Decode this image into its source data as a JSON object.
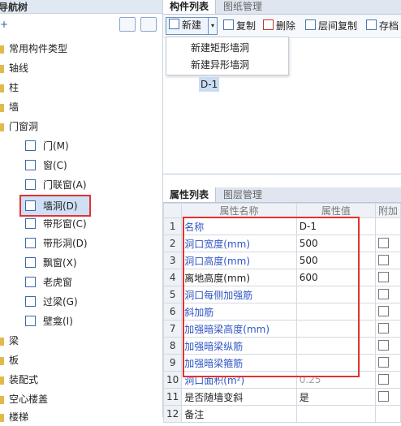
{
  "left": {
    "title": "导航树",
    "add": "+",
    "categories": [
      {
        "label": "常用构件类型"
      },
      {
        "label": "轴线"
      },
      {
        "label": "柱"
      },
      {
        "label": "墙"
      },
      {
        "label": "门窗洞"
      }
    ],
    "children": [
      {
        "label": "门(M)"
      },
      {
        "label": "窗(C)"
      },
      {
        "label": "门联窗(A)"
      },
      {
        "label": "墙洞(D)"
      },
      {
        "label": "带形窗(C)"
      },
      {
        "label": "带形洞(D)"
      },
      {
        "label": "飘窗(X)"
      },
      {
        "label": "老虎窗"
      },
      {
        "label": "过梁(G)"
      },
      {
        "label": "壁龛(I)"
      }
    ],
    "categories2": [
      {
        "label": "梁"
      },
      {
        "label": "板"
      },
      {
        "label": "装配式"
      },
      {
        "label": "空心楼盖"
      },
      {
        "label": "楼梯"
      }
    ]
  },
  "component_panel": {
    "tabs": [
      "构件列表",
      "图纸管理"
    ],
    "toolbar": {
      "new": "新建",
      "copy": "复制",
      "delete": "删除",
      "floor_copy": "层间复制",
      "save": "存档"
    },
    "dropdown": [
      "新建矩形墙洞",
      "新建异形墙洞"
    ],
    "items": [
      "D-1"
    ]
  },
  "property_panel": {
    "tabs": [
      "属性列表",
      "图层管理"
    ],
    "headers": [
      "属性名称",
      "属性值",
      "附加"
    ],
    "rows": [
      {
        "no": "1",
        "name": "名称",
        "value": "D-1"
      },
      {
        "no": "2",
        "name": "洞口宽度(mm)",
        "value": "500"
      },
      {
        "no": "3",
        "name": "洞口高度(mm)",
        "value": "500"
      },
      {
        "no": "4",
        "name": "离地高度(mm)",
        "value": "600"
      },
      {
        "no": "5",
        "name": "洞口每侧加强筋",
        "value": ""
      },
      {
        "no": "6",
        "name": "斜加筋",
        "value": ""
      },
      {
        "no": "7",
        "name": "加强暗梁高度(mm)",
        "value": ""
      },
      {
        "no": "8",
        "name": "加强暗梁纵筋",
        "value": ""
      },
      {
        "no": "9",
        "name": "加强暗梁箍筋",
        "value": ""
      },
      {
        "no": "10",
        "name": "洞口面积(m²)",
        "value": "0.25"
      },
      {
        "no": "11",
        "name": "是否随墙变斜",
        "value": "是"
      },
      {
        "no": "12",
        "name": "备注",
        "value": ""
      }
    ]
  }
}
